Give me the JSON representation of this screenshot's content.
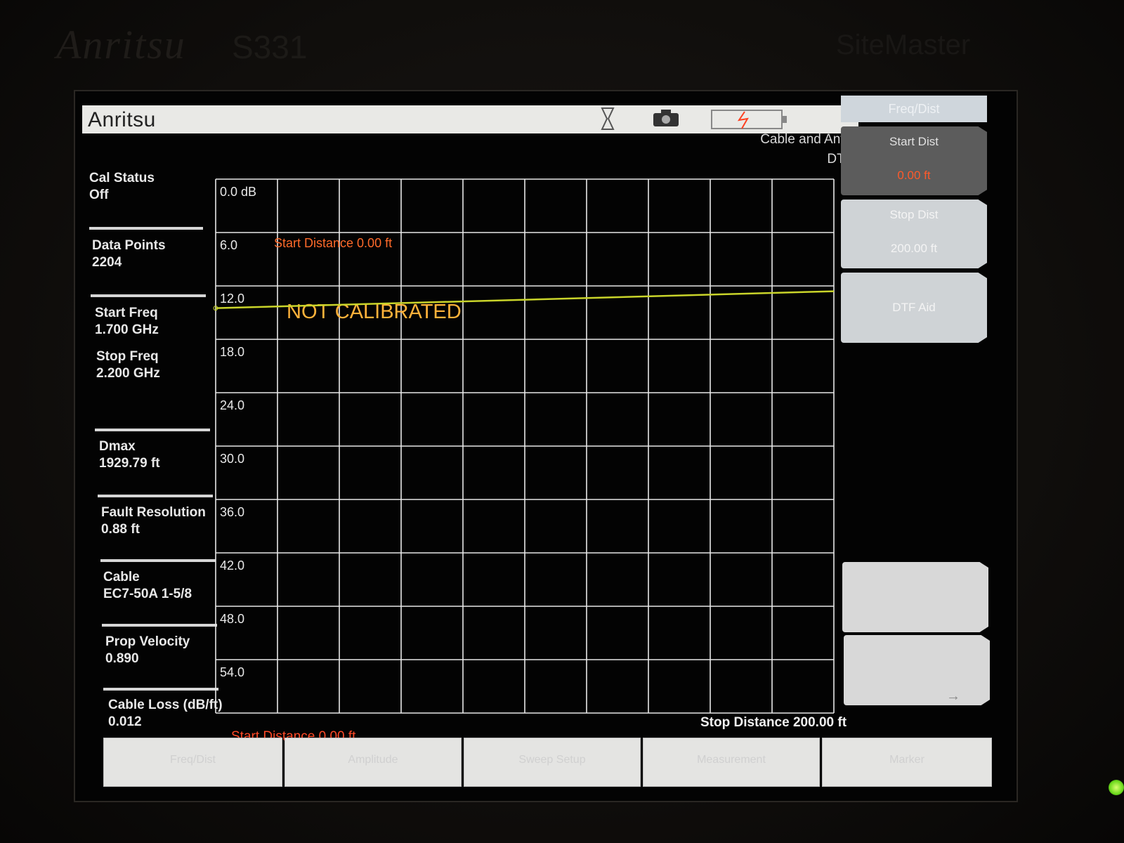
{
  "device": {
    "case_brand": "Anritsu",
    "case_model": "S331",
    "case_product": "SiteMaster"
  },
  "topbar": {
    "logo": "Anritsu",
    "icons": [
      "hourglass-icon",
      "camera-icon",
      "battery-icon"
    ]
  },
  "mode": {
    "line1": "Cable and Antenna Analyzer",
    "line2": "DTF Return Loss"
  },
  "info_panel": {
    "cal_status": {
      "label": "Cal Status",
      "value": "Off"
    },
    "data_points": {
      "label": "Data Points",
      "value": "2204"
    },
    "start_freq": {
      "label": "Start Freq",
      "value": "1.700 GHz"
    },
    "stop_freq": {
      "label": "Stop Freq",
      "value": "2.200 GHz"
    },
    "dmax": {
      "label": "Dmax",
      "value": "1929.79 ft"
    },
    "fault_resolution": {
      "label": "Fault Resolution",
      "value": "0.88 ft"
    },
    "cable": {
      "label": "Cable",
      "value": "EC7-50A 1-5/8"
    },
    "prop_velocity": {
      "label": "Prop Velocity",
      "value": "0.890"
    },
    "cable_loss": {
      "label": "Cable Loss (dB/ft)",
      "value": "0.012"
    }
  },
  "graph": {
    "y_ticks": [
      "0.0 dB",
      "6.0",
      "12.0",
      "18.0",
      "24.0",
      "30.0",
      "36.0",
      "42.0",
      "48.0",
      "54.0"
    ],
    "start_distance_marker": "Start Distance 0.00 ft",
    "warning": "NOT CALIBRATED",
    "start_distance_bottom": "Start Distance 0.00 ft",
    "stop_distance_bottom": "Stop Distance 200.00 ft",
    "trace_color": "#c9d42a",
    "grid_color": "#e8e8e8"
  },
  "chart_data": {
    "type": "line",
    "ylim": [
      0,
      60
    ],
    "y_inverted": true,
    "xlim": [
      0,
      200
    ],
    "x_unit": "ft",
    "grid": true,
    "series": [
      {
        "x": [
          0,
          200
        ],
        "values": [
          14.5,
          12.6
        ]
      }
    ]
  },
  "softkeys": {
    "header": "Freq/Dist",
    "keys": [
      {
        "title": "Start Dist",
        "value": "0.00 ft",
        "selected": true
      },
      {
        "title": "Stop Dist",
        "value": "200.00 ft",
        "selected": false
      },
      {
        "title": "DTF Aid",
        "value": "",
        "selected": false
      }
    ]
  },
  "menubar": {
    "items": [
      "Freq/Dist",
      "Amplitude",
      "Sweep Setup",
      "Measurement",
      "Marker"
    ]
  }
}
